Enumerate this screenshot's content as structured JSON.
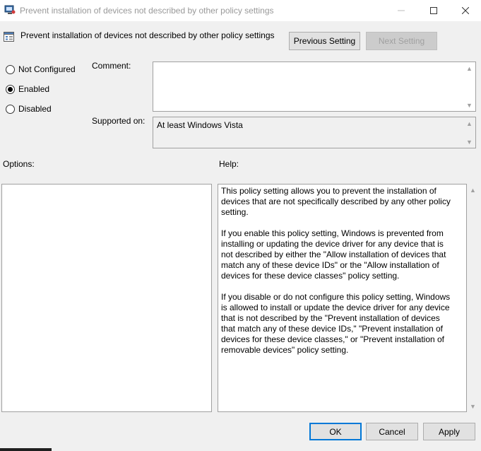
{
  "window": {
    "title": "Prevent installation of devices not described by other policy settings",
    "icon": "policy-window-icon"
  },
  "header": {
    "title": "Prevent installation of devices not described by other policy settings",
    "previous_label": "Previous Setting",
    "next_label": "Next Setting"
  },
  "state": {
    "options": [
      {
        "label": "Not Configured",
        "checked": false
      },
      {
        "label": "Enabled",
        "checked": true
      },
      {
        "label": "Disabled",
        "checked": false
      }
    ]
  },
  "comment": {
    "label": "Comment:",
    "value": ""
  },
  "supported": {
    "label": "Supported on:",
    "value": "At least Windows Vista"
  },
  "options_panel": {
    "label": "Options:"
  },
  "help": {
    "label": "Help:",
    "paragraphs": [
      "This policy setting allows you to prevent the installation of devices that are not specifically described by any other policy setting.",
      "If you enable this policy setting, Windows is prevented from installing or updating the device driver for any device that is not described by either the \"Allow installation of devices that match any of these device IDs\" or the \"Allow installation of devices for these device classes\" policy setting.",
      "If you disable or do not configure this policy setting, Windows is allowed to install or update the device driver for any device that is not described by the \"Prevent installation of devices that match any of these device IDs,\" \"Prevent installation of devices for these device classes,\" or \"Prevent installation of removable devices\" policy setting."
    ]
  },
  "footer": {
    "ok_label": "OK",
    "cancel_label": "Cancel",
    "apply_label": "Apply"
  },
  "colors": {
    "accent": "#0078d7",
    "window_bg": "#f0f0f0",
    "disabled_text": "#a0a0a0"
  }
}
